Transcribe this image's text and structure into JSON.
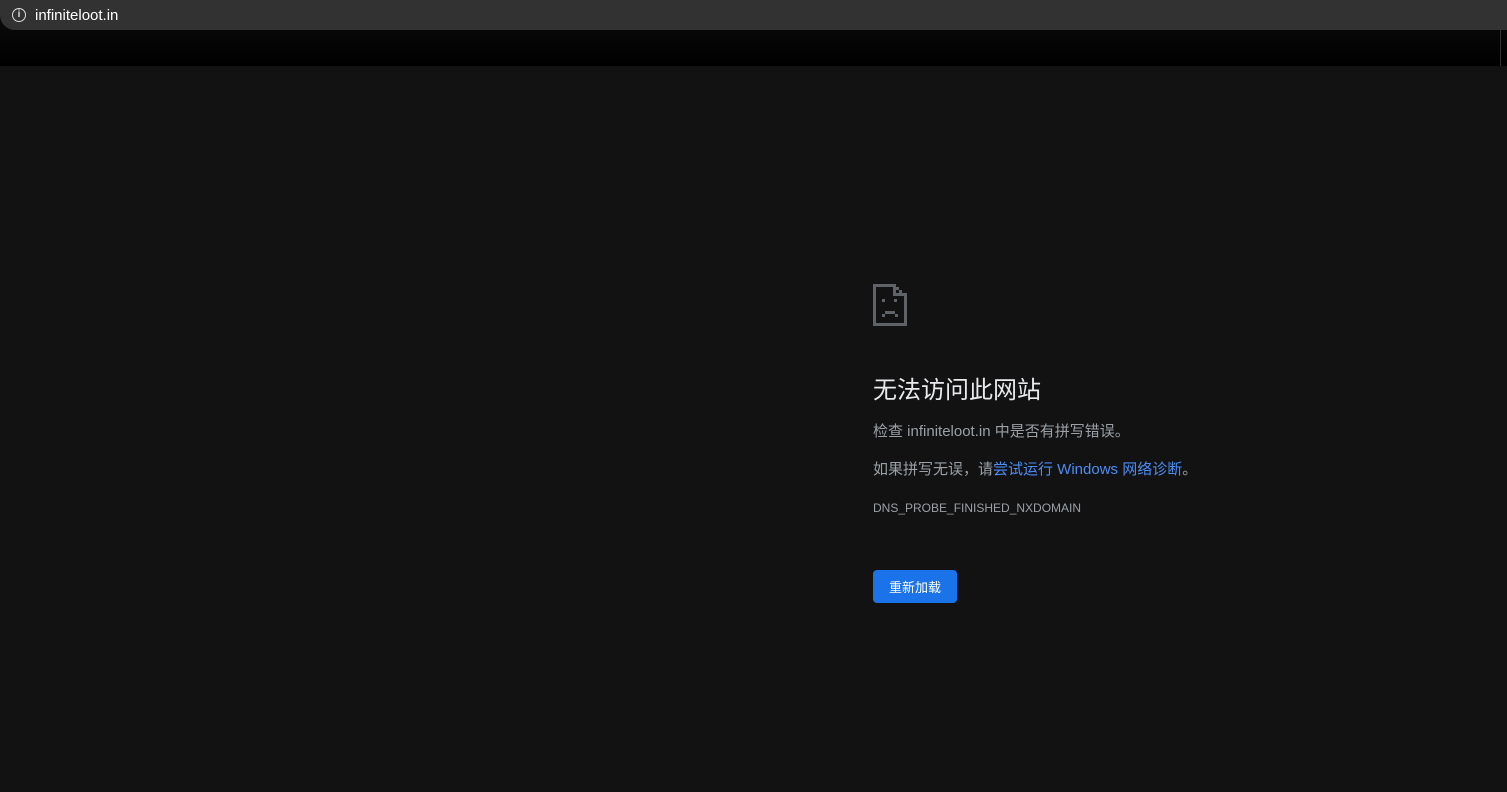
{
  "browser": {
    "url": "infiniteloot.in",
    "icon": "info-icon"
  },
  "error": {
    "icon": "sad-document-icon",
    "title": "无法访问此网站",
    "check_prefix": "检查 ",
    "check_domain": "infiniteloot.in",
    "check_suffix": " 中是否有拼写错误。",
    "suggest_prefix": "如果拼写无误，请",
    "suggest_link": "尝试运行 Windows 网络诊断",
    "suggest_suffix": "。",
    "code": "DNS_PROBE_FINISHED_NXDOMAIN",
    "reload_label": "重新加载"
  },
  "colors": {
    "accent": "#1a73e8",
    "link": "#4c8df6",
    "background": "#121212"
  }
}
